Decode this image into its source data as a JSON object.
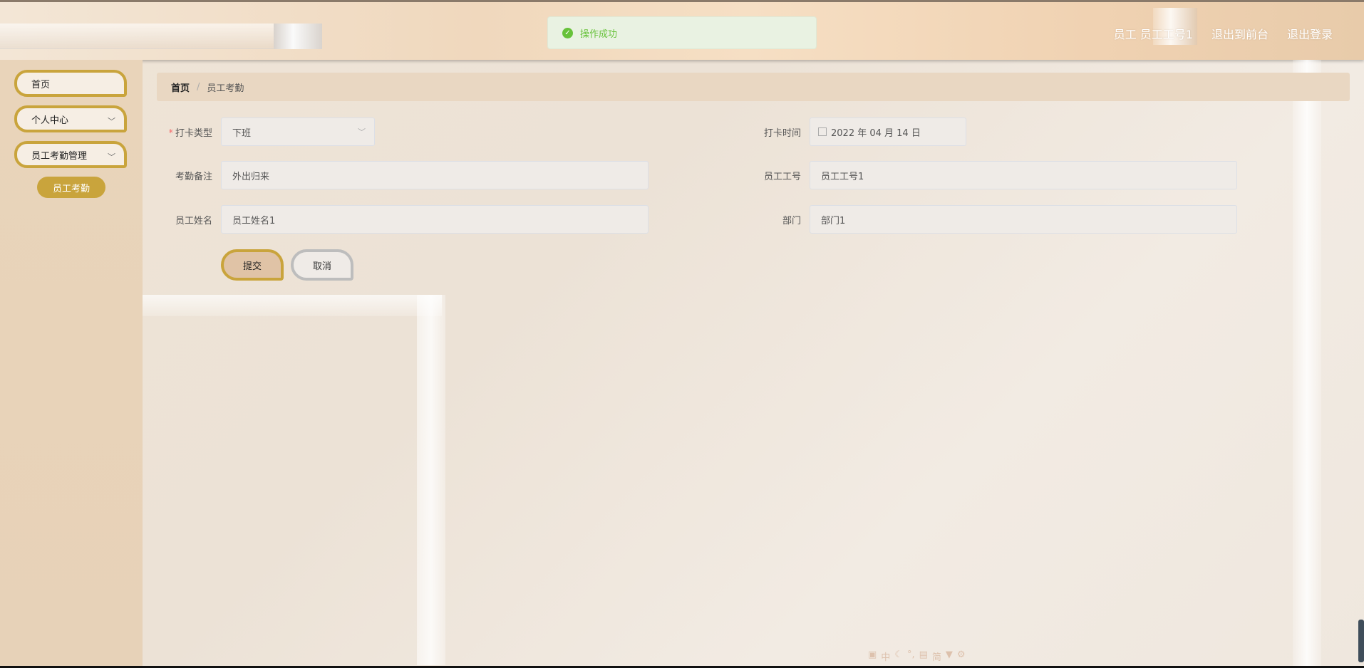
{
  "header": {
    "user_label": "员工 员工工号1",
    "back_front_link": "退出到前台",
    "logout_link": "退出登录"
  },
  "toast": {
    "message": "操作成功",
    "icon": "check-circle-icon",
    "color": "#67c23a"
  },
  "sidebar": {
    "items": [
      {
        "label": "首页"
      },
      {
        "label": "个人中心"
      },
      {
        "label": "员工考勤管理"
      }
    ],
    "sub_item": "员工考勤",
    "accent": "#c9a43c"
  },
  "breadcrumb": {
    "home": "首页",
    "separator": "/",
    "current": "员工考勤"
  },
  "form": {
    "punch_type": {
      "label": "打卡类型",
      "value": "下班",
      "required_mark": "*"
    },
    "punch_time": {
      "label": "打卡时间",
      "value": "2022 年 04 月 14 日"
    },
    "remark": {
      "label": "考勤备注",
      "value": "外出归来"
    },
    "employee_id": {
      "label": "员工工号",
      "value": "员工工号1"
    },
    "employee_name": {
      "label": "员工姓名",
      "value": "员工姓名1"
    },
    "department": {
      "label": "部门",
      "value": "部门1"
    },
    "submit_label": "提交",
    "cancel_label": "取消"
  },
  "bottom_toolbar": {
    "glyphs": [
      "中",
      "简"
    ]
  }
}
